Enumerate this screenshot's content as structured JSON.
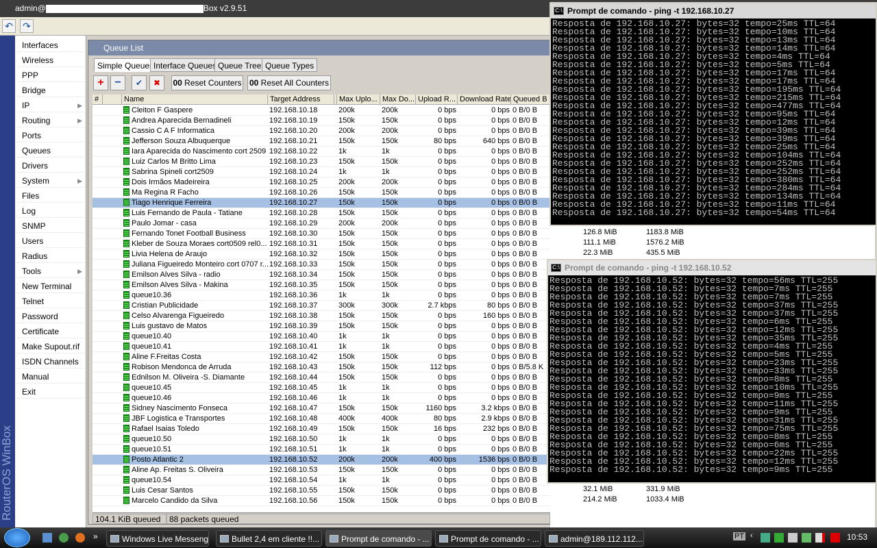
{
  "window": {
    "title_prefix": "admin@",
    "title_suffix": "Box v2.9.51",
    "brand": "RouterOS WinBox"
  },
  "toolbar": {
    "undo": "↶",
    "redo": "↷"
  },
  "menu": [
    {
      "label": "Interfaces"
    },
    {
      "label": "Wireless"
    },
    {
      "label": "PPP"
    },
    {
      "label": "Bridge"
    },
    {
      "label": "IP",
      "sub": true
    },
    {
      "label": "Routing",
      "sub": true
    },
    {
      "label": "Ports"
    },
    {
      "label": "Queues"
    },
    {
      "label": "Drivers"
    },
    {
      "label": "System",
      "sub": true
    },
    {
      "label": "Files"
    },
    {
      "label": "Log"
    },
    {
      "label": "SNMP"
    },
    {
      "label": "Users"
    },
    {
      "label": "Radius"
    },
    {
      "label": "Tools",
      "sub": true
    },
    {
      "label": "New Terminal"
    },
    {
      "label": "Telnet"
    },
    {
      "label": "Password"
    },
    {
      "label": "Certificate"
    },
    {
      "label": "Make Supout.rif"
    },
    {
      "label": "ISDN Channels"
    },
    {
      "label": "Manual"
    },
    {
      "label": "Exit"
    }
  ],
  "queue_list": {
    "title": "Queue List",
    "tabs": [
      "Simple Queues",
      "Interface Queues",
      "Queue Tree",
      "Queue Types"
    ],
    "buttons": {
      "add": "+",
      "remove": "−",
      "enable": "✔",
      "disable": "✖",
      "reset": "Reset Counters",
      "reset_all": "Reset All Counters",
      "counter_icon": "00"
    },
    "columns": [
      "#",
      "",
      "Name",
      "Target Address",
      "",
      "Max Uplo...",
      "Max Do...",
      "Upload R...",
      "Download Rate",
      "Queued B"
    ],
    "rows": [
      [
        "Cleiton F Gaspere",
        "192.168.10.18",
        "200k",
        "200k",
        "0 bps",
        "0 bps",
        "0 B/0 B"
      ],
      [
        "Andrea Aparecida Bernadineli",
        "192.168.10.19",
        "150k",
        "150k",
        "0 bps",
        "0 bps",
        "0 B/0 B"
      ],
      [
        "Cassio C A F Informatica",
        "192.168.10.20",
        "200k",
        "200k",
        "0 bps",
        "0 bps",
        "0 B/0 B"
      ],
      [
        "Jefferson Souza Albuquerque",
        "192.168.10.21",
        "150k",
        "150k",
        "80 bps",
        "640 bps",
        "0 B/0 B"
      ],
      [
        "Iara Aparecida do Nascimento cort 2509",
        "192.168.10.22",
        "1k",
        "1k",
        "0 bps",
        "0 bps",
        "0 B/0 B"
      ],
      [
        "Luiz Carlos M Britto Lima",
        "192.168.10.23",
        "150k",
        "150k",
        "0 bps",
        "0 bps",
        "0 B/0 B"
      ],
      [
        "Sabrina Spineli cort2509",
        "192.168.10.24",
        "1k",
        "1k",
        "0 bps",
        "0 bps",
        "0 B/0 B"
      ],
      [
        "Dois Irmãos Madeireira",
        "192.168.10.25",
        "200k",
        "200k",
        "0 bps",
        "0 bps",
        "0 B/0 B"
      ],
      [
        "Ma Regina R Facho",
        "192.168.10.26",
        "150k",
        "150k",
        "0 bps",
        "0 bps",
        "0 B/0 B"
      ],
      [
        "Tiago Henrique Ferreira",
        "192.168.10.27",
        "150k",
        "150k",
        "0 bps",
        "0 bps",
        "0 B/0 B"
      ],
      [
        "Luis Fernando de Paula - Tatiane",
        "192.168.10.28",
        "150k",
        "150k",
        "0 bps",
        "0 bps",
        "0 B/0 B"
      ],
      [
        "Paulo Jomar - casa",
        "192.168.10.29",
        "200k",
        "200k",
        "0 bps",
        "0 bps",
        "0 B/0 B"
      ],
      [
        "Fernando Tonet Football Business",
        "192.168.10.30",
        "150k",
        "150k",
        "0 bps",
        "0 bps",
        "0 B/0 B"
      ],
      [
        "Kleber de Souza Moraes cort0509 rel0...",
        "192.168.10.31",
        "150k",
        "150k",
        "0 bps",
        "0 bps",
        "0 B/0 B"
      ],
      [
        "Livia Helena de Araujo",
        "192.168.10.32",
        "150k",
        "150k",
        "0 bps",
        "0 bps",
        "0 B/0 B"
      ],
      [
        "Juliana Figueiredo Monteiro cort 0707 r...",
        "192.168.10.33",
        "150k",
        "150k",
        "0 bps",
        "0 bps",
        "0 B/0 B"
      ],
      [
        "Emilson Alves Silva - radio",
        "192.168.10.34",
        "150k",
        "150k",
        "0 bps",
        "0 bps",
        "0 B/0 B"
      ],
      [
        "Emilson Alves Silva - Makina",
        "192.168.10.35",
        "150k",
        "150k",
        "0 bps",
        "0 bps",
        "0 B/0 B"
      ],
      [
        "queue10.36",
        "192.168.10.36",
        "1k",
        "1k",
        "0 bps",
        "0 bps",
        "0 B/0 B"
      ],
      [
        "Cristian Publicidade",
        "192.168.10.37",
        "300k",
        "300k",
        "2.7 kbps",
        "80 bps",
        "0 B/0 B"
      ],
      [
        "Celso Alvarenga Figueiredo",
        "192.168.10.38",
        "150k",
        "150k",
        "0 bps",
        "160 bps",
        "0 B/0 B"
      ],
      [
        "Luis gustavo de Matos",
        "192.168.10.39",
        "150k",
        "150k",
        "0 bps",
        "0 bps",
        "0 B/0 B"
      ],
      [
        "queue10.40",
        "192.168.10.40",
        "1k",
        "1k",
        "0 bps",
        "0 bps",
        "0 B/0 B"
      ],
      [
        "queue10.41",
        "192.168.10.41",
        "1k",
        "1k",
        "0 bps",
        "0 bps",
        "0 B/0 B"
      ],
      [
        "Aline F.Freitas Costa",
        "192.168.10.42",
        "150k",
        "150k",
        "0 bps",
        "0 bps",
        "0 B/0 B"
      ],
      [
        "Robison Mendonca de Arruda",
        "192.168.10.43",
        "150k",
        "150k",
        "112 bps",
        "0 bps",
        "0 B/5.8 K"
      ],
      [
        "Ednilson M. Oliveira -S. Diamante",
        "192.168.10.44",
        "150k",
        "150k",
        "0 bps",
        "0 bps",
        "0 B/0 B"
      ],
      [
        "queue10.45",
        "192.168.10.45",
        "1k",
        "1k",
        "0 bps",
        "0 bps",
        "0 B/0 B"
      ],
      [
        "queue10.46",
        "192.168.10.46",
        "1k",
        "1k",
        "0 bps",
        "0 bps",
        "0 B/0 B"
      ],
      [
        "Sidney Nascimento Fonseca",
        "192.168.10.47",
        "150k",
        "150k",
        "1160 bps",
        "3.2 kbps",
        "0 B/0 B"
      ],
      [
        "JBF Logistica e Transportes",
        "192.168.10.48",
        "400k",
        "400k",
        "80 bps",
        "2.9 kbps",
        "0 B/0 B"
      ],
      [
        "Rafael Isaias Toledo",
        "192.168.10.49",
        "150k",
        "150k",
        "16 bps",
        "232 bps",
        "0 B/0 B"
      ],
      [
        "queue10.50",
        "192.168.10.50",
        "1k",
        "1k",
        "0 bps",
        "0 bps",
        "0 B/0 B"
      ],
      [
        "queue10.51",
        "192.168.10.51",
        "1k",
        "1k",
        "0 bps",
        "0 bps",
        "0 B/0 B"
      ],
      [
        "Posto Atlantic 2",
        "192.168.10.52",
        "200k",
        "200k",
        "400 bps",
        "1536 bps",
        "0 B/0 B"
      ],
      [
        "Aline Ap. Freitas S. Oliveira",
        "192.168.10.53",
        "150k",
        "150k",
        "0 bps",
        "0 bps",
        "0 B/0 B"
      ],
      [
        "queue10.54",
        "192.168.10.54",
        "1k",
        "1k",
        "0 bps",
        "0 bps",
        "0 B/0 B"
      ],
      [
        "Luis Cesar Santos",
        "192.168.10.55",
        "150k",
        "150k",
        "0 bps",
        "0 bps",
        "0 B/0 B"
      ],
      [
        "Marcelo Candido da Silva",
        "192.168.10.56",
        "150k",
        "150k",
        "0 bps",
        "0 bps",
        "0 B/0 B"
      ]
    ],
    "selected_rows": [
      9,
      34
    ],
    "bytes_visible": [
      {
        "row": 12,
        "up": "126.8 MiB",
        "down": "1183.8 MiB"
      },
      {
        "row": 13,
        "up": "111.1 MiB",
        "down": "1576.2 MiB"
      },
      {
        "row": 14,
        "up": "22.3 MiB",
        "down": "435.5 MiB"
      },
      {
        "row": 37,
        "up": "32.1 MiB",
        "down": "331.9 MiB"
      },
      {
        "row": 38,
        "up": "214.2 MiB",
        "down": "1033.4 MiB"
      }
    ],
    "status": {
      "queued_bytes": "104.1 KiB queued",
      "queued_packets": "88 packets queued"
    }
  },
  "console1": {
    "title": "Prompt de comando - ping -t 192.168.10.27",
    "ip": "192.168.10.27",
    "ttl": "64",
    "times": [
      "25",
      "10",
      "13",
      "14",
      "4",
      "5",
      "17",
      "17",
      "195",
      "215",
      "477",
      "95",
      "12",
      "39",
      "39",
      "25",
      "104",
      "252",
      "252",
      "380",
      "284",
      "134",
      "11",
      "54"
    ]
  },
  "console2": {
    "title": "Prompt de comando - ping -t 192.168.10.52",
    "ip": "192.168.10.52",
    "ttl": "255",
    "times": [
      "56",
      "7",
      "7",
      "37",
      "37",
      "6",
      "12",
      "35",
      "4",
      "5",
      "23",
      "33",
      "8",
      "10",
      "9",
      "11",
      "9",
      "31",
      "75",
      "8",
      "6",
      "22",
      "12",
      "9"
    ]
  },
  "taskbar": {
    "items": [
      {
        "label": "Windows Live Messenger"
      },
      {
        "label": "Bullet 2,4 em cliente !!..."
      },
      {
        "label": "Prompt de comando - ...",
        "active": true
      },
      {
        "label": "Prompt de comando - ..."
      },
      {
        "label": "admin@189.112.112...."
      }
    ],
    "language": "PT",
    "clock": "10:53"
  }
}
